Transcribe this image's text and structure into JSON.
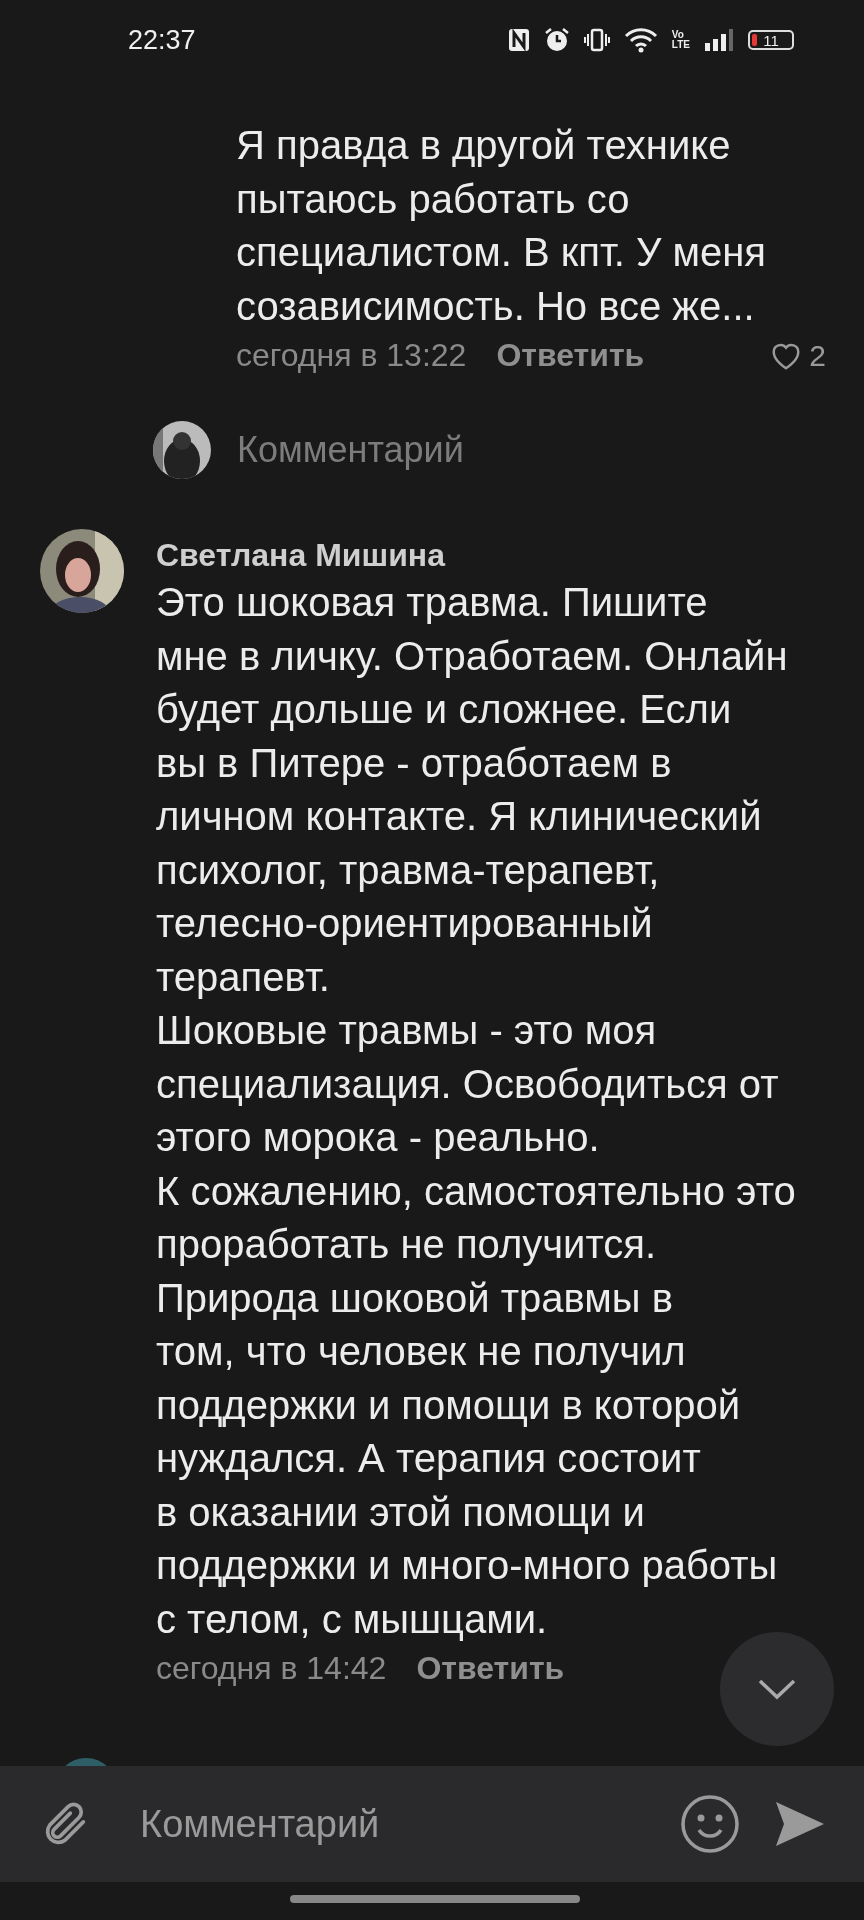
{
  "status_bar": {
    "time": "22:37",
    "volte_top": "Vo",
    "volte_bottom": "LTE",
    "battery": "11"
  },
  "comments": [
    {
      "kind": "cut",
      "text": "Я правда в другой технике\nпытаюсь работать со\nспециалистом. В кпт. У меня\nсозависимость. Но все же...",
      "time": "сегодня в 13:22",
      "reply": "Ответить",
      "likes": "2"
    },
    {
      "kind": "reply_field",
      "placeholder": "Комментарий"
    },
    {
      "kind": "full",
      "author": "Светлана Мишина",
      "text": "Это шоковая травма. Пишите\nмне в личку. Отработаем. Онлайн\nбудет дольше и сложнее. Если\nвы в Питере - отработаем в\nличном контакте. Я клинический\nпсихолог, травма-терапевт,\nтелесно-ориентированный\nтерапевт.\nШоковые травмы - это моя\nспециализация. Освободиться от\nэтого морока - реально.\nК сожалению, самостоятельно это\nпроработать не получится.\nПрирода шоковой травмы в\nтом, что человек не получил\nподдержки и помощи в которой\nнуждался. А терапия состоит\nв оказании этой помощи и\nподдержки и много-много работы\nс телом, с мышцами.",
      "time": "сегодня в 14:42",
      "reply": "Ответить"
    }
  ],
  "composer": {
    "placeholder": "Комментарий"
  }
}
